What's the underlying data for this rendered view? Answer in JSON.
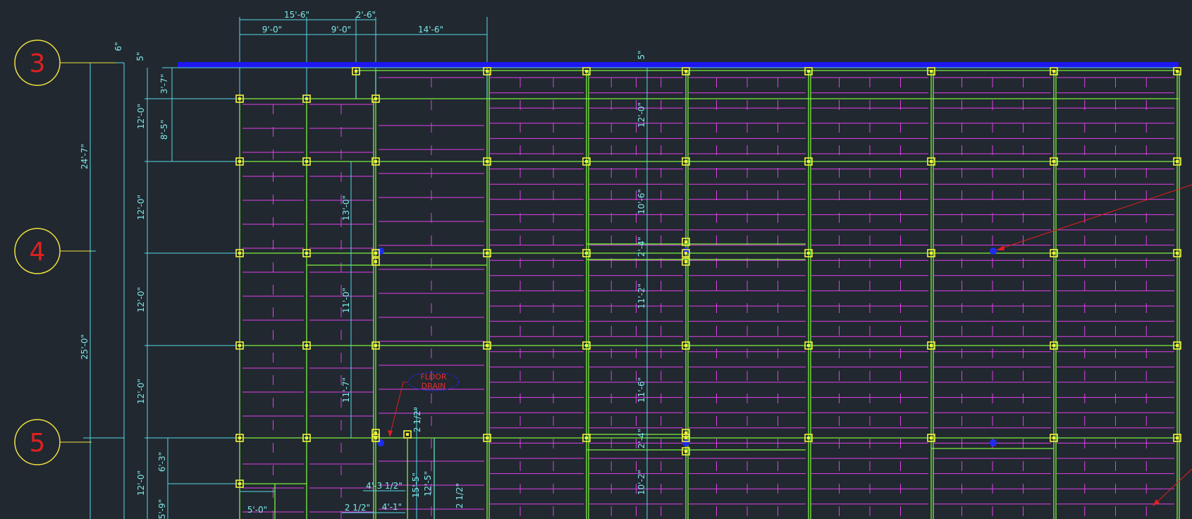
{
  "drawing": {
    "background": "#212830",
    "colors": {
      "beam": "#7cf03c",
      "joist": "#e040e8",
      "dimension": "#56d8e4",
      "column": "#f2f23a",
      "grid_bubble": "#f0e040",
      "grid_text": "#e02020",
      "slab_edge": "#1e18f0",
      "leader": "#e02020",
      "floor_drain": "#1e2cf0"
    },
    "grid_bubbles": [
      {
        "label": "3"
      },
      {
        "label": "4"
      },
      {
        "label": "5"
      }
    ],
    "top_dims": {
      "overall": [
        "15'-6\"",
        "2'-6\""
      ],
      "bays": [
        "9'-0\"",
        "9'-0\"",
        "14'-6\""
      ]
    },
    "left_dims": {
      "outer_small": "6\"",
      "outer": [
        "24'-7\"",
        "25'-0\""
      ],
      "edge_small": "5\"",
      "mid": [
        "12'-0\"",
        "12'-0\"",
        "12'-0\"",
        "12'-0\"",
        "12'-0\""
      ],
      "inner_top": [
        "3'-7\"",
        "8'-5\""
      ],
      "inner_bottom": [
        "6'-3\"",
        "5'-9\""
      ]
    },
    "interior_dims": {
      "col_a": [
        "13'-0\"",
        "11'-0\"",
        "11'-7\""
      ],
      "col_b": [
        "5\"",
        "12'-0\"",
        "10'-6\"",
        "2'-4\"",
        "11'-2\"",
        "11'-6\"",
        "2'-4\"",
        "10'-2\""
      ],
      "bottom": [
        "2 1/2\"",
        "15'-5\"",
        "12'-5\"",
        "2 1/2\"",
        "4'-3 1/2\"",
        "2 1/2\"",
        "4'-1\"",
        "5'-0\""
      ]
    },
    "floor_drain": {
      "line1": "FLOOR",
      "line2": "DRAIN"
    }
  }
}
